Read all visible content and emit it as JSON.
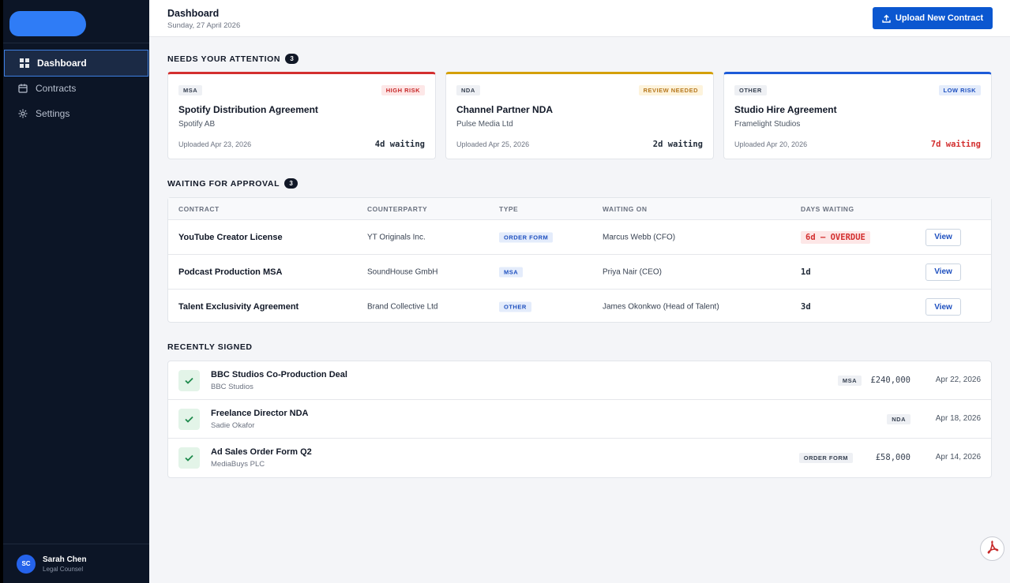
{
  "sidebar": {
    "nav": [
      {
        "label": "Dashboard",
        "icon": "grid-icon",
        "active": true
      },
      {
        "label": "Contracts",
        "icon": "calendar-icon"
      },
      {
        "label": "Settings",
        "icon": "gear-icon"
      }
    ],
    "user": {
      "initials": "SC",
      "name": "Sarah Chen",
      "role": "Legal Counsel"
    }
  },
  "header": {
    "title": "Dashboard",
    "date": "Sunday, 27 April 2026",
    "upload_label": "Upload New Contract"
  },
  "attention": {
    "title": "NEEDS YOUR ATTENTION",
    "count": "3",
    "cards": [
      {
        "type": "MSA",
        "risk": "HIGH RISK",
        "title": "Spotify Distribution Agreement",
        "party": "Spotify AB",
        "uploaded": "Uploaded Apr 23, 2026",
        "waiting": "4d waiting"
      },
      {
        "type": "NDA",
        "risk": "REVIEW NEEDED",
        "title": "Channel Partner NDA",
        "party": "Pulse Media Ltd",
        "uploaded": "Uploaded Apr 25, 2026",
        "waiting": "2d waiting"
      },
      {
        "type": "OTHER",
        "risk": "LOW RISK",
        "title": "Studio Hire Agreement",
        "party": "Framelight Studios",
        "uploaded": "Uploaded Apr 20, 2026",
        "waiting": "7d waiting"
      }
    ]
  },
  "approval": {
    "title": "WAITING FOR APPROVAL",
    "count": "3",
    "columns": [
      "CONTRACT",
      "COUNTERPARTY",
      "TYPE",
      "WAITING ON",
      "DAYS WAITING"
    ],
    "view_label": "View",
    "rows": [
      {
        "contract": "YouTube Creator License",
        "counterparty": "YT Originals Inc.",
        "type": "ORDER FORM",
        "waiting_on": "Marcus Webb (CFO)",
        "days": "6d — OVERDUE"
      },
      {
        "contract": "Podcast Production MSA",
        "counterparty": "SoundHouse GmbH",
        "type": "MSA",
        "waiting_on": "Priya Nair (CEO)",
        "days": "1d"
      },
      {
        "contract": "Talent Exclusivity Agreement",
        "counterparty": "Brand Collective Ltd",
        "type": "OTHER",
        "waiting_on": "James Okonkwo (Head of Talent)",
        "days": "3d"
      }
    ]
  },
  "signed": {
    "title": "RECENTLY SIGNED",
    "rows": [
      {
        "title": "BBC Studios Co-Production Deal",
        "party": "BBC Studios",
        "type": "MSA",
        "amount": "£240,000",
        "date": "Apr 22, 2026"
      },
      {
        "title": "Freelance Director NDA",
        "party": "Sadie Okafor",
        "type": "NDA",
        "amount": "",
        "date": "Apr 18, 2026"
      },
      {
        "title": "Ad Sales Order Form Q2",
        "party": "MediaBuys PLC",
        "type": "ORDER FORM",
        "amount": "£58,000",
        "date": "Apr 14, 2026"
      }
    ]
  },
  "colors": {
    "sidebar": "#0c1526",
    "accent": "#0b57d0",
    "danger": "#d32f2f",
    "warning": "#d4a00a"
  }
}
